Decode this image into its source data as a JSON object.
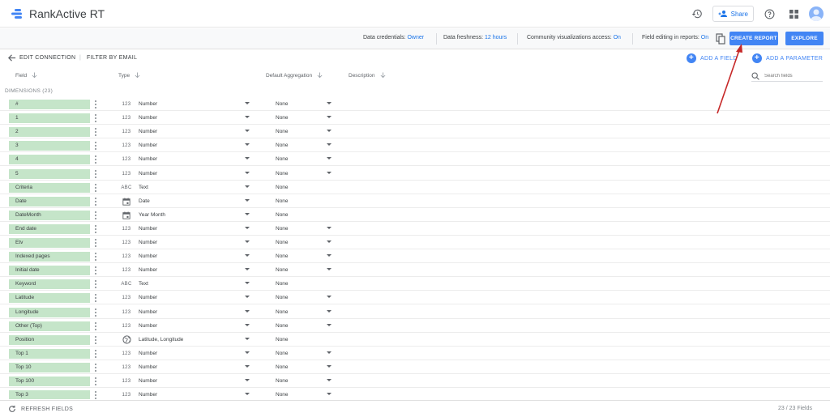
{
  "app": {
    "title": "RankActive RT",
    "colors": {
      "accent": "#4285f4",
      "field_chip": "#c5e5c9",
      "annotation": "#c62828"
    }
  },
  "header": {
    "icons": [
      "history-icon",
      "share-icon",
      "help-icon",
      "apps-grid-icon",
      "avatar"
    ],
    "share_label": "Share"
  },
  "subbar": {
    "credentials_label": "Data credentials:",
    "credentials_value": "Owner",
    "freshness_label": "Data freshness:",
    "freshness_value": "12 hours",
    "community_label": "Community visualizations access:",
    "community_value": "On",
    "editing_label": "Field editing in reports:",
    "editing_value": "On",
    "create_report": "CREATE REPORT",
    "explore": "EXPLORE"
  },
  "connection": {
    "edit": "EDIT CONNECTION",
    "divider": "|",
    "filter": "FILTER BY EMAIL",
    "add_field": "ADD A FIELD",
    "add_parameter": "ADD A PARAMETER"
  },
  "columns": {
    "field": "Field",
    "type": "Type",
    "aggregation": "Default Aggregation",
    "description": "Description",
    "search_placeholder": "Search fields"
  },
  "dimensions_label": "DIMENSIONS (23)",
  "rows": [
    {
      "field": "#",
      "type_icon": "123",
      "type": "Number",
      "agg": "None",
      "agg_dropdown": true
    },
    {
      "field": "1",
      "type_icon": "123",
      "type": "Number",
      "agg": "None",
      "agg_dropdown": true
    },
    {
      "field": "2",
      "type_icon": "123",
      "type": "Number",
      "agg": "None",
      "agg_dropdown": true
    },
    {
      "field": "3",
      "type_icon": "123",
      "type": "Number",
      "agg": "None",
      "agg_dropdown": true
    },
    {
      "field": "4",
      "type_icon": "123",
      "type": "Number",
      "agg": "None",
      "agg_dropdown": true
    },
    {
      "field": "5",
      "type_icon": "123",
      "type": "Number",
      "agg": "None",
      "agg_dropdown": true
    },
    {
      "field": "Criteria",
      "type_icon": "ABC",
      "type": "Text",
      "agg": "None",
      "agg_dropdown": false
    },
    {
      "field": "Date",
      "type_icon": "calendar",
      "type": "Date",
      "agg": "None",
      "agg_dropdown": false
    },
    {
      "field": "DateMonth",
      "type_icon": "calendar",
      "type": "Year Month",
      "agg": "None",
      "agg_dropdown": false
    },
    {
      "field": "End date",
      "type_icon": "123",
      "type": "Number",
      "agg": "None",
      "agg_dropdown": true
    },
    {
      "field": "Etv",
      "type_icon": "123",
      "type": "Number",
      "agg": "None",
      "agg_dropdown": true
    },
    {
      "field": "Indexed pages",
      "type_icon": "123",
      "type": "Number",
      "agg": "None",
      "agg_dropdown": true
    },
    {
      "field": "Initial date",
      "type_icon": "123",
      "type": "Number",
      "agg": "None",
      "agg_dropdown": true
    },
    {
      "field": "Keyword",
      "type_icon": "ABC",
      "type": "Text",
      "agg": "None",
      "agg_dropdown": false
    },
    {
      "field": "Latitude",
      "type_icon": "123",
      "type": "Number",
      "agg": "None",
      "agg_dropdown": true
    },
    {
      "field": "Longitude",
      "type_icon": "123",
      "type": "Number",
      "agg": "None",
      "agg_dropdown": true
    },
    {
      "field": "Other (Top)",
      "type_icon": "123",
      "type": "Number",
      "agg": "None",
      "agg_dropdown": true
    },
    {
      "field": "Position",
      "type_icon": "globe",
      "type": "Latitude, Longitude",
      "agg": "None",
      "agg_dropdown": false
    },
    {
      "field": "Top 1",
      "type_icon": "123",
      "type": "Number",
      "agg": "None",
      "agg_dropdown": true
    },
    {
      "field": "Top 10",
      "type_icon": "123",
      "type": "Number",
      "agg": "None",
      "agg_dropdown": true
    },
    {
      "field": "Top 100",
      "type_icon": "123",
      "type": "Number",
      "agg": "None",
      "agg_dropdown": true
    },
    {
      "field": "Top 3",
      "type_icon": "123",
      "type": "Number",
      "agg": "None",
      "agg_dropdown": true
    }
  ],
  "footer": {
    "refresh": "REFRESH FIELDS",
    "count": "23 / 23 Fields"
  }
}
